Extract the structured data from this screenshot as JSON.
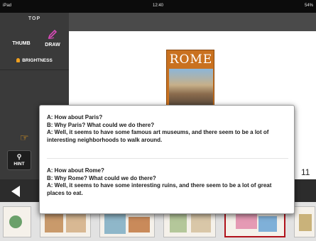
{
  "status_bar": {
    "device": "iPad",
    "time": "12:40",
    "battery": "54%"
  },
  "toolbar": {
    "top_label": "TOP",
    "thumb_label": "THUMB",
    "draw_label": "DRAW",
    "brightness_label": "BRIGHTNESS",
    "hint_label": "HINT"
  },
  "book": {
    "cover_title": "ROME",
    "page_number": "11"
  },
  "dialogue": [
    {
      "lines": [
        "A: How about Paris?",
        "B: Why Paris? What could we do there?",
        "A: Well, it seems to have some famous art museums, and there seem to be a lot of interesting neighborhoods to walk around."
      ]
    },
    {
      "lines": [
        "A: How about Rome?",
        "B: Why Rome? What could we do there?",
        "A: Well, it seems to have some interesting ruins, and there seem to be a lot of great places to eat."
      ]
    }
  ],
  "icons": {
    "thumb": "grid-icon",
    "draw": "pencil-icon",
    "brightness": "bulb-icon",
    "hand": "hand-icon",
    "hint": "pin-icon",
    "prev": "left-arrow-icon"
  },
  "colors": {
    "accent": "#4aa3e8",
    "selected_thumb": "#b0121b",
    "cover": "#c9711f"
  }
}
